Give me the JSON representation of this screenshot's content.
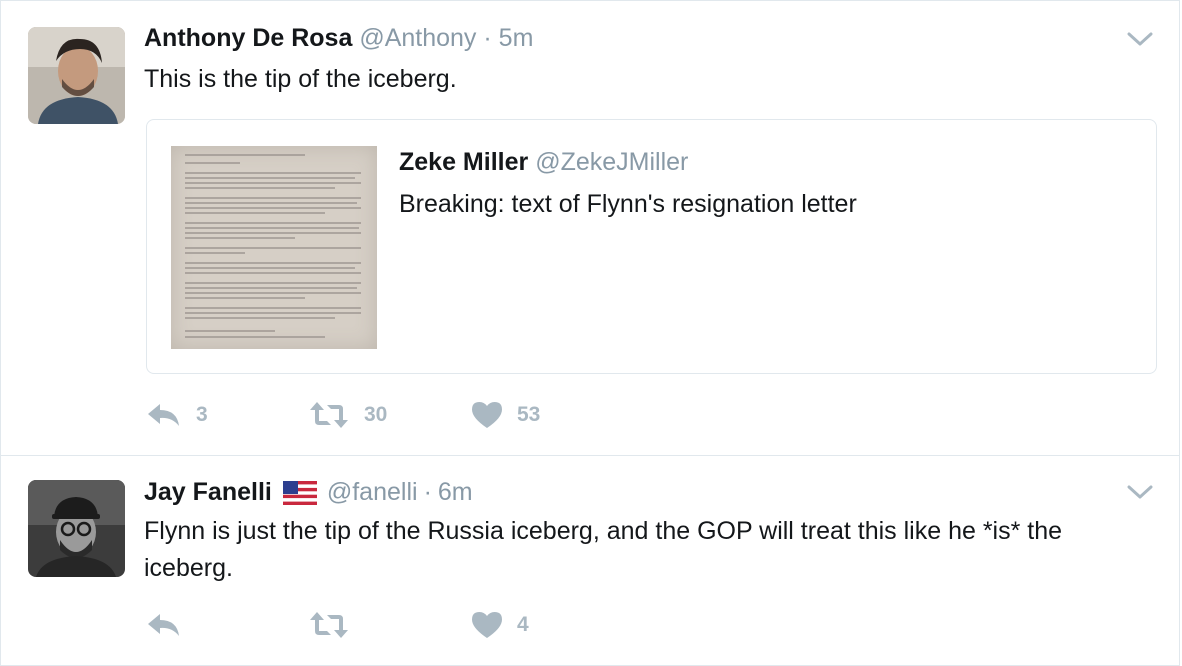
{
  "tweets": [
    {
      "name": "Anthony De Rosa",
      "handle": "@Anthony",
      "separator": "·",
      "time": "5m",
      "text": "This is the tip of the iceberg.",
      "quote": {
        "name": "Zeke Miller",
        "handle": "@ZekeJMiller",
        "text": "Breaking: text of Flynn's resignation letter"
      },
      "replies": "3",
      "retweets": "30",
      "likes": "53"
    },
    {
      "name": "Jay Fanelli",
      "flag": "us-flag-emoji",
      "handle": "@fanelli",
      "separator": "·",
      "time": "6m",
      "text": "Flynn is just the tip of the Russia iceberg, and the GOP will treat this like he *is* the iceberg.",
      "replies": "",
      "retweets": "",
      "likes": "4"
    }
  ],
  "icons": {
    "reply": "reply-icon",
    "retweet": "retweet-icon",
    "like": "heart-icon",
    "menu": "chevron-down-icon"
  },
  "colors": {
    "text": "#14171a",
    "secondary": "#8899a6",
    "action": "#aab8c2",
    "border": "#e1e8ed"
  }
}
